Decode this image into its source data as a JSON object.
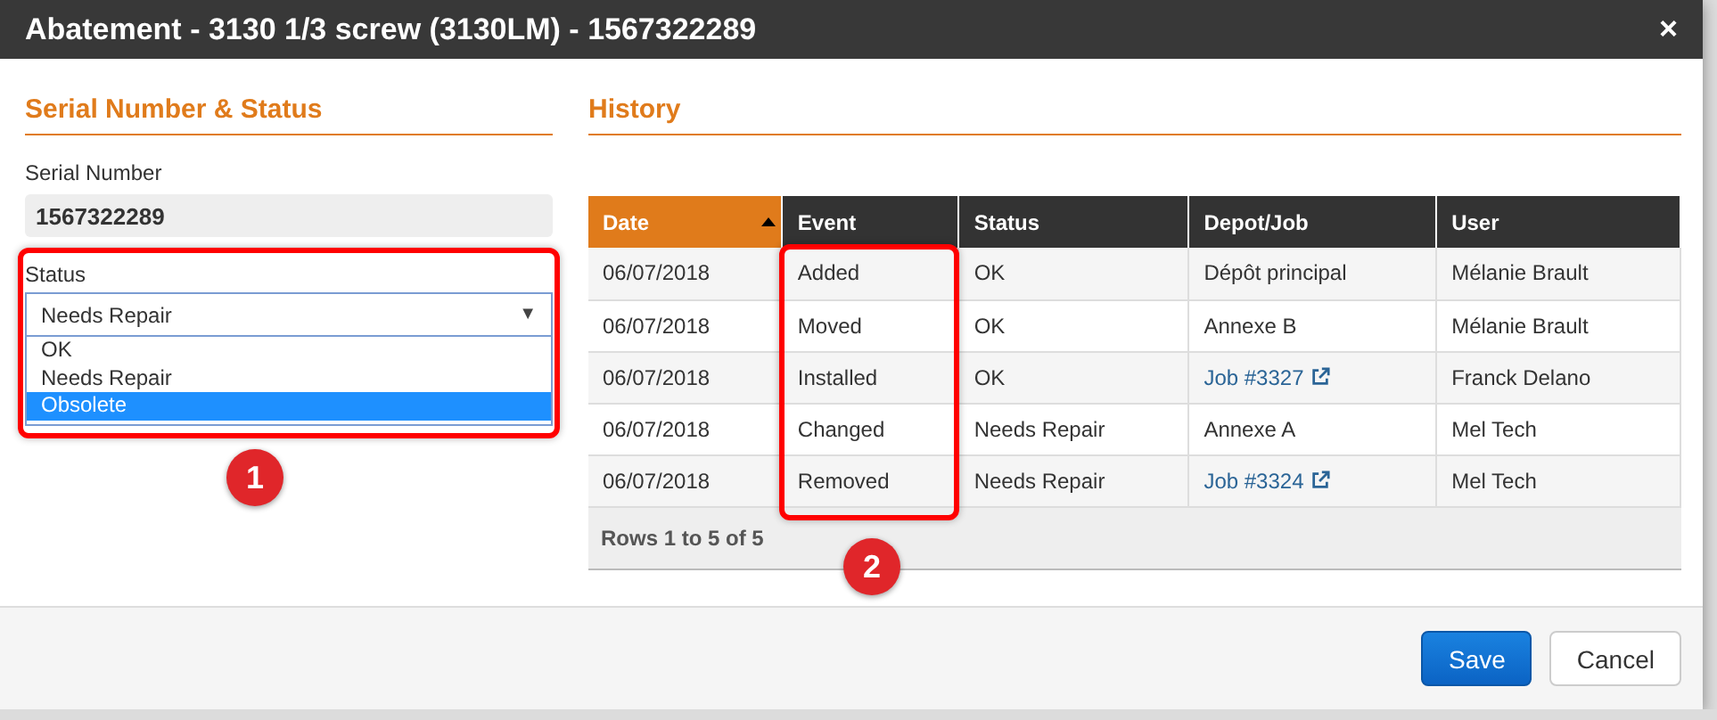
{
  "window": {
    "title": "Abatement - 3130 1/3 screw (3130LM) - 1567322289",
    "close": "×"
  },
  "serial_status": {
    "heading": "Serial Number & Status",
    "serial_label": "Serial Number",
    "serial_value": "1567322289",
    "status_label": "Status",
    "status_value": "Needs Repair",
    "caret": "▼",
    "status_open": true,
    "options": [
      {
        "label": "OK",
        "selected": false
      },
      {
        "label": "Needs Repair",
        "selected": false
      },
      {
        "label": "Obsolete",
        "selected": true
      }
    ],
    "annotation": "1"
  },
  "history": {
    "heading": "History",
    "annotation": "2",
    "columns": [
      {
        "label": "Date",
        "sorted": true
      },
      {
        "label": "Event",
        "sorted": false
      },
      {
        "label": "Status",
        "sorted": false
      },
      {
        "label": "Depot/Job",
        "sorted": false
      },
      {
        "label": "User",
        "sorted": false
      }
    ],
    "rows": [
      {
        "date": "06/07/2018",
        "event": "Added",
        "status": "OK",
        "depot_job": "Dépôt principal",
        "link": false,
        "user": "Mélanie Brault"
      },
      {
        "date": "06/07/2018",
        "event": "Moved",
        "status": "OK",
        "depot_job": "Annexe B",
        "link": false,
        "user": "Mélanie Brault"
      },
      {
        "date": "06/07/2018",
        "event": "Installed",
        "status": "OK",
        "depot_job": "Job #3327",
        "link": true,
        "user": "Franck Delano"
      },
      {
        "date": "06/07/2018",
        "event": "Changed",
        "status": "Needs Repair",
        "depot_job": "Annexe A",
        "link": false,
        "user": "Mel Tech"
      },
      {
        "date": "06/07/2018",
        "event": "Removed",
        "status": "Needs Repair",
        "depot_job": "Job #3324",
        "link": true,
        "user": "Mel Tech"
      }
    ],
    "footer": "Rows 1 to 5 of 5"
  },
  "buttons": [
    {
      "label": "Save",
      "kind": "primary"
    },
    {
      "label": "Cancel",
      "kind": "default"
    }
  ]
}
